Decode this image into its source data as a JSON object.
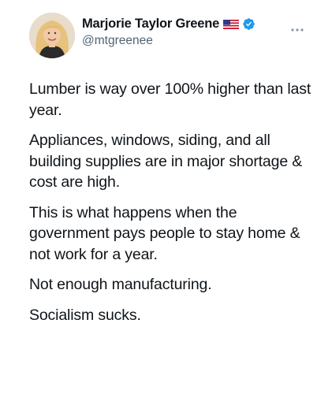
{
  "author": {
    "display_name": "Marjorie Taylor Greene",
    "handle": "@mtgreenee",
    "flag_icon": "us-flag-icon",
    "verified_icon": "verified-badge-icon",
    "verified_color": "#1d9bf0"
  },
  "more_icon": "more-horizontal-icon",
  "tweet": {
    "paragraphs": [
      "Lumber is way over 100% higher than last year.",
      "Appliances, windows, siding, and all building supplies are in major shortage & cost are high.",
      "This is what happens when the government pays people to stay home & not work for a year.",
      "Not enough manufacturing.",
      "Socialism sucks."
    ]
  }
}
